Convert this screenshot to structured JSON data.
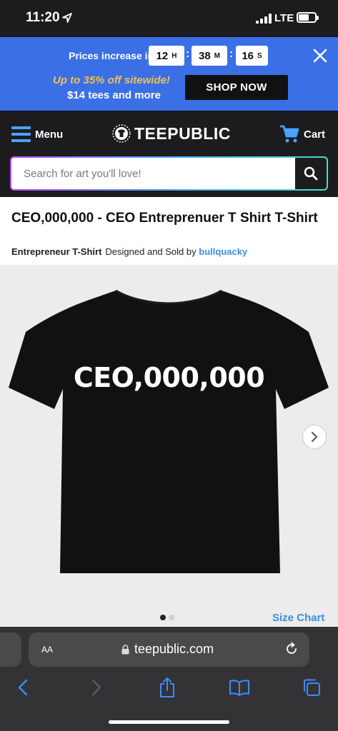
{
  "status_bar": {
    "time": "11:20",
    "network": "LTE"
  },
  "promo": {
    "price_text": "Prices increase in",
    "hours": "12",
    "hours_unit": "H",
    "minutes": "38",
    "minutes_unit": "M",
    "seconds": "16",
    "seconds_unit": "S",
    "offer_line1": "Up to 35% off sitewide!",
    "offer_line2": "$14 tees and more",
    "cta": "SHOP NOW"
  },
  "header": {
    "menu_label": "Menu",
    "logo_text": "TEEPUBLIC",
    "cart_label": "Cart",
    "search_placeholder": "Search for art you'll love!"
  },
  "product": {
    "title": "CEO,000,000 - CEO Entreprenuer T Shirt T-Shirt",
    "kind": "Entrepreneur T-Shirt",
    "designed_by_text": "Designed and Sold by",
    "artist": "bullquacky",
    "shirt_print": "CEO,000,000",
    "size_chart": "Size Chart"
  },
  "safari": {
    "aa_label": "AA",
    "url": "teepublic.com"
  },
  "colors": {
    "promo_bg": "#3b6fe6",
    "offer_yellow": "#f4c14a",
    "link_blue": "#3b8ee0",
    "header_bg": "#1c1c1e"
  }
}
